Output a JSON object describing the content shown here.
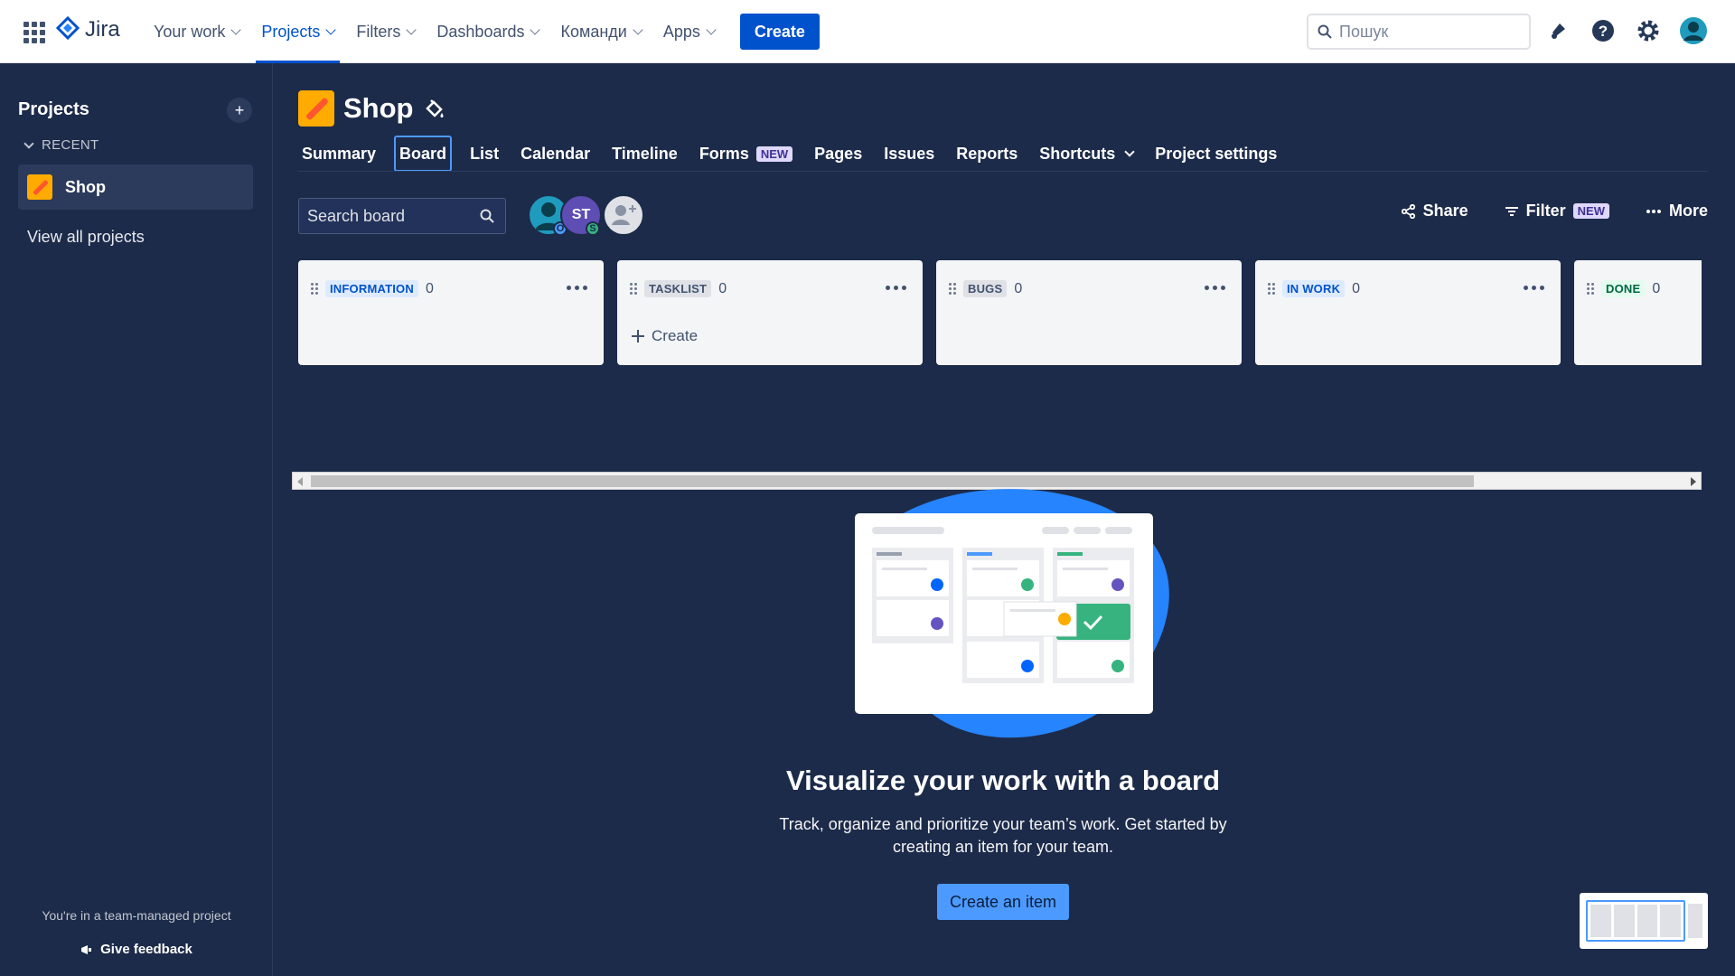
{
  "topnav": {
    "logo": "Jira",
    "items": [
      {
        "label": "Your work"
      },
      {
        "label": "Projects"
      },
      {
        "label": "Filters"
      },
      {
        "label": "Dashboards"
      },
      {
        "label": "Команди"
      },
      {
        "label": "Apps"
      }
    ],
    "active": "Projects",
    "create_label": "Create",
    "search_placeholder": "Пошук",
    "icons": [
      "notifications-icon",
      "help-icon",
      "settings-icon",
      "profile-avatar"
    ]
  },
  "sidebar": {
    "title": "Projects",
    "recent_label": "RECENT",
    "project_name": "Shop",
    "view_all": "View all projects",
    "footer_text": "You're in a team-managed project",
    "feedback": "Give feedback"
  },
  "project": {
    "title": "Shop",
    "tabs": [
      {
        "label": "Summary"
      },
      {
        "label": "Board"
      },
      {
        "label": "List"
      },
      {
        "label": "Calendar"
      },
      {
        "label": "Timeline"
      },
      {
        "label": "Forms"
      },
      {
        "label": "Pages"
      },
      {
        "label": "Issues"
      },
      {
        "label": "Reports"
      },
      {
        "label": "Shortcuts"
      },
      {
        "label": "Project settings"
      }
    ],
    "active_tab": "Board",
    "new_badge": "NEW"
  },
  "toolbar": {
    "search_placeholder": "Search board",
    "avatar_initials": "ST",
    "avatar_badge_o": "O",
    "avatar_badge_s": "S",
    "share": "Share",
    "filter": "Filter",
    "filter_badge": "NEW",
    "more": "More"
  },
  "columns": [
    {
      "name": "INFORMATION",
      "count": "0",
      "color": "#0052cc",
      "bg": "#deebff"
    },
    {
      "name": "TASKLIST",
      "count": "0",
      "color": "#42526e",
      "bg": "#dfe1e6"
    },
    {
      "name": "BUGS",
      "count": "0",
      "color": "#42526e",
      "bg": "#dfe1e6"
    },
    {
      "name": "IN WORK",
      "count": "0",
      "color": "#0052cc",
      "bg": "#deebff"
    },
    {
      "name": "DONE",
      "count": "0",
      "color": "#006644",
      "bg": "#e3fcef"
    }
  ],
  "column_create": "Create",
  "empty_state": {
    "title": "Visualize your work with a board",
    "description": "Track, organize and prioritize your team’s work. Get started by creating an item for your team.",
    "button": "Create an item"
  }
}
